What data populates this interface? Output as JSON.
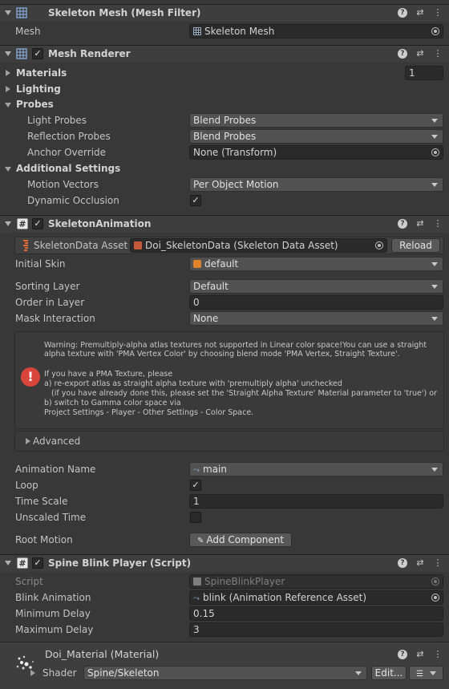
{
  "mesh_filter": {
    "title": "Skeleton Mesh (Mesh Filter)",
    "mesh_label": "Mesh",
    "mesh_value": "Skeleton Mesh"
  },
  "mesh_renderer": {
    "title": "Mesh Renderer",
    "enabled": true,
    "materials_label": "Materials",
    "materials_count": "1",
    "lighting_label": "Lighting",
    "probes_label": "Probes",
    "light_probes_label": "Light Probes",
    "light_probes_value": "Blend Probes",
    "reflection_probes_label": "Reflection Probes",
    "reflection_probes_value": "Blend Probes",
    "anchor_override_label": "Anchor Override",
    "anchor_override_value": "None (Transform)",
    "additional_settings_label": "Additional Settings",
    "motion_vectors_label": "Motion Vectors",
    "motion_vectors_value": "Per Object Motion",
    "dynamic_occlusion_label": "Dynamic Occlusion",
    "dynamic_occlusion_checked": true
  },
  "skeleton_animation": {
    "title": "SkeletonAnimation",
    "enabled": true,
    "data_asset_label": "SkeletonData Asset",
    "data_asset_value": "Doi_SkeletonData (Skeleton Data Asset)",
    "reload_label": "Reload",
    "initial_skin_label": "Initial Skin",
    "initial_skin_value": "default",
    "sorting_layer_label": "Sorting Layer",
    "sorting_layer_value": "Default",
    "order_in_layer_label": "Order in Layer",
    "order_in_layer_value": "0",
    "mask_interaction_label": "Mask Interaction",
    "mask_interaction_value": "None",
    "warning_lines": [
      "Warning: Premultiply-alpha atlas textures not supported in Linear color space!You can use a straight",
      "alpha texture with 'PMA Vertex Color' by choosing blend mode 'PMA Vertex, Straight Texture'.",
      "",
      "If you have a PMA Texture, please",
      "a) re-export atlas as straight alpha texture with 'premultiply alpha' unchecked",
      "   (if you have already done this, please set the 'Straight Alpha Texture' Material parameter to 'true') or",
      "b) switch to Gamma color space via",
      "Project Settings - Player - Other Settings - Color Space."
    ],
    "advanced_label": "Advanced",
    "animation_name_label": "Animation Name",
    "animation_name_value": "main",
    "loop_label": "Loop",
    "loop_checked": true,
    "time_scale_label": "Time Scale",
    "time_scale_value": "1",
    "unscaled_time_label": "Unscaled Time",
    "unscaled_time_checked": false,
    "root_motion_label": "Root Motion",
    "add_component_label": "Add Component"
  },
  "blink_player": {
    "title": "Spine Blink Player (Script)",
    "enabled": true,
    "script_label": "Script",
    "script_value": "SpineBlinkPlayer",
    "blink_animation_label": "Blink Animation",
    "blink_animation_value": "blink (Animation Reference Asset)",
    "minimum_delay_label": "Minimum Delay",
    "minimum_delay_value": "0.15",
    "maximum_delay_label": "Maximum Delay",
    "maximum_delay_value": "3"
  },
  "material": {
    "title": "Doi_Material (Material)",
    "shader_label": "Shader",
    "shader_value": "Spine/Skeleton",
    "edit_label": "Edit...",
    "list_icon": "list-icon"
  },
  "colors": {
    "background": "#383838",
    "header": "#3e3e3e",
    "field": "#2a2a2a",
    "dropdown": "#515151",
    "error": "#d8453a"
  }
}
